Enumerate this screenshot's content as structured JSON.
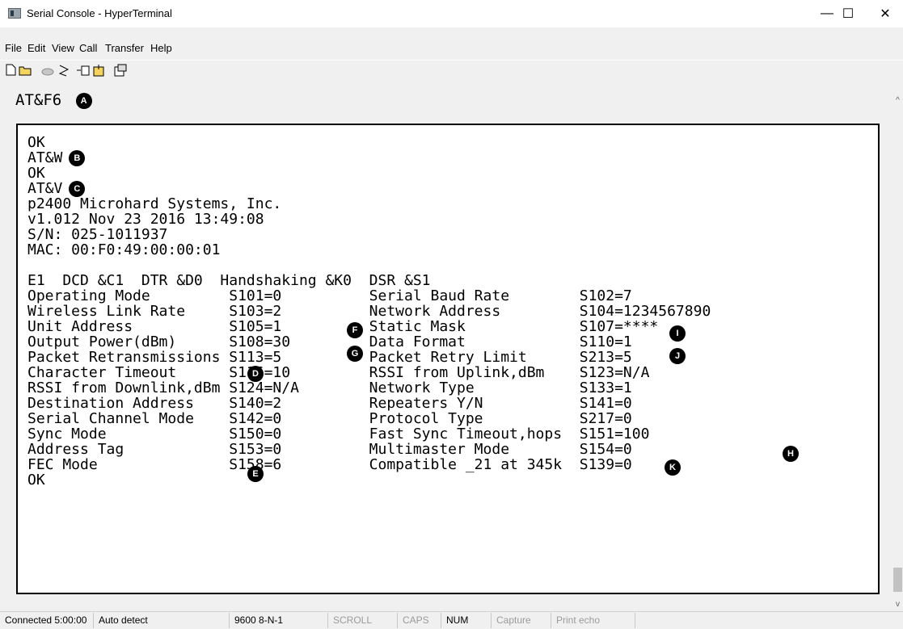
{
  "window": {
    "title": "Serial Console - HyperTerminal",
    "minimize_glyph": "—",
    "maximize_glyph": "☐",
    "close_glyph": "✕"
  },
  "menu": {
    "file": "File",
    "edit": "Edit",
    "view": "View",
    "call": "Call",
    "transfer": "Transfer",
    "help": "Help"
  },
  "toolbar": {
    "new_icon": "new-connection-icon",
    "open_icon": "open-folder-icon",
    "connect_icon": "call-icon",
    "disconnect_icon": "disconnect-icon",
    "send_icon": "send-file-icon",
    "receive_icon": "receive-file-icon",
    "properties_icon": "properties-icon"
  },
  "callouts": {
    "top_command": "AT&F6",
    "A": "A",
    "B": "B",
    "C": "C",
    "D": "D",
    "E": "E",
    "F": "F",
    "G": "G",
    "H": "H",
    "I": "I",
    "J": "J",
    "K": "K"
  },
  "terminal": {
    "lines": [
      "OK",
      "AT&W",
      "OK",
      "AT&V",
      "p2400 Microhard Systems, Inc.",
      "v1.012 Nov 23 2016 13:49:08",
      "S/N: 025-1011937",
      "MAC: 00:F0:49:00:00:01",
      "",
      "E1  DCD &C1  DTR &D0  Handshaking &K0  DSR &S1",
      "Operating Mode         S101=0          Serial Baud Rate        S102=7",
      "Wireless Link Rate     S103=2          Network Address         S104=1234567890",
      "Unit Address           S105=1          Static Mask             S107=****",
      "Output Power(dBm)      S108=30         Data Format             S110=1",
      "Packet Retransmissions S113=5          Packet Retry Limit      S213=5",
      "Character Timeout      S116=10         RSSI from Uplink,dBm    S123=N/A",
      "RSSI from Downlink,dBm S124=N/A        Network Type            S133=1",
      "Destination Address    S140=2          Repeaters Y/N           S141=0",
      "Serial Channel Mode    S142=0          Protocol Type           S217=0",
      "Sync Mode              S150=0          Fast Sync Timeout,hops  S151=100",
      "Address Tag            S153=0          Multimaster Mode        S154=0",
      "FEC Mode               S158=6          Compatible _21 at 345k  S139=0",
      "OK"
    ]
  },
  "status": {
    "connected": "Connected 5:00:00",
    "detect": "Auto detect",
    "settings": "9600 8-N-1",
    "scroll": "SCROLL",
    "caps": "CAPS",
    "num": "NUM",
    "capture": "Capture",
    "print_echo": "Print echo"
  },
  "scroll": {
    "up_glyph": "^",
    "down_glyph": "v"
  }
}
